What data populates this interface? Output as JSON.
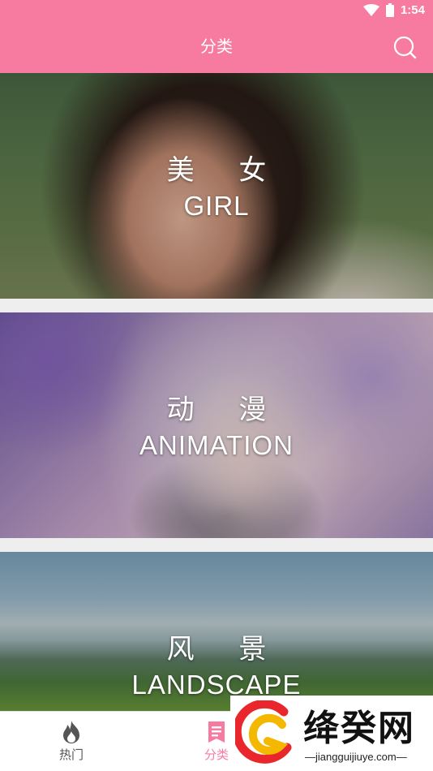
{
  "status_bar": {
    "time": "1:54"
  },
  "app_bar": {
    "title": "分类"
  },
  "categories": [
    {
      "title_cn": "美 女",
      "title_en": "GIRL"
    },
    {
      "title_cn": "动 漫",
      "title_en": "ANIMATION"
    },
    {
      "title_cn": "风 景",
      "title_en": "LANDSCAPE"
    }
  ],
  "tab_bar": {
    "tabs": [
      {
        "label": "热门",
        "icon": "flame-icon",
        "active": false
      },
      {
        "label": "分类",
        "icon": "category-list-icon",
        "active": true
      }
    ]
  },
  "watermark": {
    "text": "绛癸网",
    "url": "—jiangguijiuye.com—"
  },
  "colors": {
    "accent": "#f77ba0",
    "tab_inactive": "#555555",
    "background": "#eeeeee"
  }
}
